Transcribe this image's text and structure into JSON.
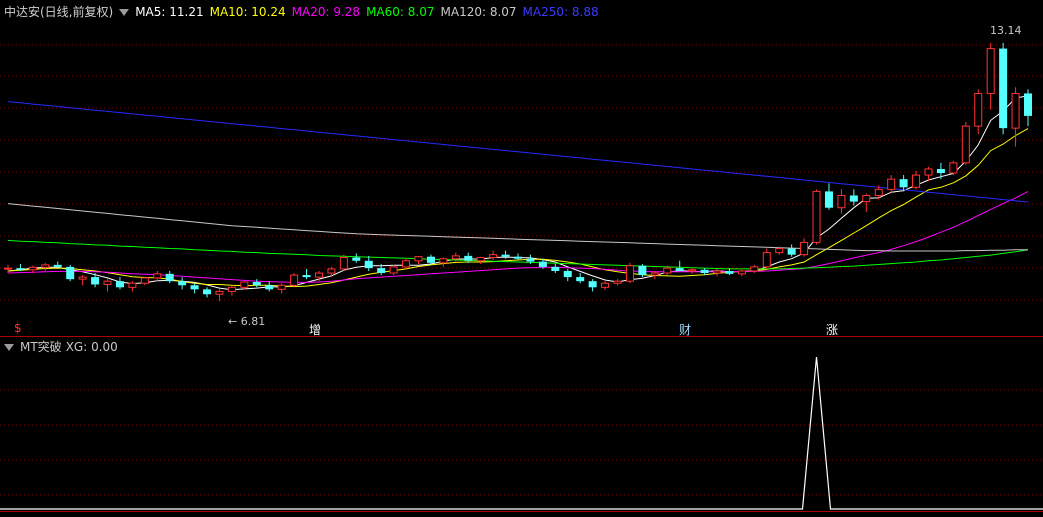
{
  "header": {
    "title": "中达安(日线,前复权)",
    "ma5": "MA5: 11.21",
    "ma10": "MA10: 10.24",
    "ma20": "MA20: 9.28",
    "ma60": "MA60: 8.07",
    "ma120": "MA120: 8.07",
    "ma250": "MA250: 8.88"
  },
  "indicator": {
    "title": "MT突破",
    "xg": "XG: 0.00"
  },
  "labels": {
    "high": "13.14",
    "low": "6.81"
  },
  "markers": [
    {
      "text": "$",
      "color": "#ff3030"
    },
    {
      "text": "增",
      "color": "#ffffff"
    },
    {
      "text": "财",
      "color": "#9fdcff"
    },
    {
      "text": "涨",
      "color": "#ffffff"
    }
  ],
  "colors": {
    "up": "#ff3232",
    "down": "#54ffff",
    "ma5": "#ffffff",
    "ma10": "#ffff00",
    "ma20": "#ff00ff",
    "ma60": "#00ff00",
    "ma120": "#c8c8c8",
    "ma250": "#2828ff",
    "grid": "#7a0000",
    "divider": "#b00000"
  },
  "chart_data": [
    {
      "type": "candlestick",
      "title": "中达安(日线,前复权)",
      "ylim": [
        6.3,
        13.7
      ],
      "ohlc": [
        [
          7.6,
          7.7,
          7.5,
          7.62
        ],
        [
          7.62,
          7.72,
          7.55,
          7.58
        ],
        [
          7.58,
          7.68,
          7.5,
          7.64
        ],
        [
          7.64,
          7.75,
          7.55,
          7.7
        ],
        [
          7.7,
          7.78,
          7.6,
          7.65
        ],
        [
          7.65,
          7.7,
          7.3,
          7.35
        ],
        [
          7.35,
          7.45,
          7.2,
          7.4
        ],
        [
          7.4,
          7.5,
          7.15,
          7.22
        ],
        [
          7.22,
          7.35,
          7.05,
          7.3
        ],
        [
          7.3,
          7.4,
          7.1,
          7.15
        ],
        [
          7.15,
          7.3,
          7.05,
          7.25
        ],
        [
          7.25,
          7.4,
          7.2,
          7.38
        ],
        [
          7.38,
          7.55,
          7.3,
          7.48
        ],
        [
          7.48,
          7.55,
          7.25,
          7.3
        ],
        [
          7.3,
          7.4,
          7.1,
          7.2
        ],
        [
          7.2,
          7.25,
          7.0,
          7.1
        ],
        [
          7.1,
          7.15,
          6.9,
          6.98
        ],
        [
          6.98,
          7.1,
          6.81,
          7.05
        ],
        [
          7.05,
          7.2,
          6.95,
          7.15
        ],
        [
          7.15,
          7.3,
          7.1,
          7.28
        ],
        [
          7.28,
          7.35,
          7.15,
          7.2
        ],
        [
          7.2,
          7.3,
          7.05,
          7.1
        ],
        [
          7.1,
          7.25,
          7.0,
          7.2
        ],
        [
          7.2,
          7.5,
          7.15,
          7.45
        ],
        [
          7.45,
          7.6,
          7.35,
          7.4
        ],
        [
          7.4,
          7.55,
          7.3,
          7.5
        ],
        [
          7.5,
          7.65,
          7.4,
          7.6
        ],
        [
          7.6,
          7.95,
          7.55,
          7.88
        ],
        [
          7.88,
          7.98,
          7.75,
          7.8
        ],
        [
          7.8,
          7.92,
          7.55,
          7.62
        ],
        [
          7.62,
          7.72,
          7.45,
          7.5
        ],
        [
          7.5,
          7.7,
          7.45,
          7.65
        ],
        [
          7.65,
          7.85,
          7.6,
          7.8
        ],
        [
          7.8,
          7.92,
          7.72,
          7.9
        ],
        [
          7.9,
          7.95,
          7.7,
          7.75
        ],
        [
          7.75,
          7.88,
          7.65,
          7.85
        ],
        [
          7.85,
          8.0,
          7.78,
          7.92
        ],
        [
          7.92,
          8.0,
          7.75,
          7.8
        ],
        [
          7.8,
          7.9,
          7.72,
          7.88
        ],
        [
          7.88,
          8.05,
          7.82,
          7.95
        ],
        [
          7.95,
          8.05,
          7.85,
          7.9
        ],
        [
          7.9,
          7.98,
          7.82,
          7.85
        ],
        [
          7.85,
          7.95,
          7.72,
          7.78
        ],
        [
          7.78,
          7.85,
          7.6,
          7.65
        ],
        [
          7.65,
          7.72,
          7.5,
          7.55
        ],
        [
          7.55,
          7.6,
          7.3,
          7.4
        ],
        [
          7.4,
          7.5,
          7.25,
          7.3
        ],
        [
          7.3,
          7.35,
          7.05,
          7.15
        ],
        [
          7.15,
          7.3,
          7.08,
          7.25
        ],
        [
          7.25,
          7.35,
          7.2,
          7.3
        ],
        [
          7.3,
          7.75,
          7.25,
          7.68
        ],
        [
          7.68,
          7.72,
          7.4,
          7.45
        ],
        [
          7.45,
          7.55,
          7.35,
          7.5
        ],
        [
          7.5,
          7.68,
          7.45,
          7.62
        ],
        [
          7.62,
          7.8,
          7.55,
          7.55
        ],
        [
          7.55,
          7.62,
          7.48,
          7.58
        ],
        [
          7.58,
          7.62,
          7.45,
          7.5
        ],
        [
          7.5,
          7.6,
          7.42,
          7.55
        ],
        [
          7.55,
          7.62,
          7.45,
          7.48
        ],
        [
          7.48,
          7.58,
          7.42,
          7.55
        ],
        [
          7.55,
          7.7,
          7.5,
          7.65
        ],
        [
          7.65,
          8.1,
          7.6,
          8.0
        ],
        [
          8.0,
          8.15,
          7.95,
          8.1
        ],
        [
          8.1,
          8.2,
          7.9,
          7.95
        ],
        [
          7.95,
          8.35,
          7.9,
          8.25
        ],
        [
          8.25,
          9.55,
          8.2,
          9.5
        ],
        [
          9.5,
          9.7,
          9.05,
          9.1
        ],
        [
          9.1,
          9.55,
          8.95,
          9.4
        ],
        [
          9.4,
          9.55,
          9.15,
          9.25
        ],
        [
          9.25,
          9.45,
          9.0,
          9.4
        ],
        [
          9.4,
          9.65,
          9.3,
          9.55
        ],
        [
          9.55,
          9.9,
          9.45,
          9.8
        ],
        [
          9.8,
          9.9,
          9.5,
          9.6
        ],
        [
          9.6,
          10.0,
          9.55,
          9.9
        ],
        [
          9.9,
          10.1,
          9.75,
          10.05
        ],
        [
          10.05,
          10.2,
          9.8,
          9.95
        ],
        [
          9.95,
          10.25,
          9.9,
          10.2
        ],
        [
          10.2,
          11.2,
          10.15,
          11.1
        ],
        [
          11.1,
          12.0,
          10.9,
          11.9
        ],
        [
          11.9,
          13.14,
          11.5,
          13.0
        ],
        [
          13.0,
          13.14,
          10.9,
          11.05
        ],
        [
          11.05,
          12.05,
          10.6,
          11.9
        ],
        [
          11.9,
          12.0,
          11.1,
          11.35
        ]
      ],
      "series": [
        {
          "name": "MA5",
          "values": [
            7.55,
            7.58,
            7.62,
            7.64,
            7.64,
            7.58,
            7.53,
            7.46,
            7.38,
            7.28,
            7.24,
            7.26,
            7.31,
            7.32,
            7.3,
            7.27,
            7.21,
            7.13,
            7.09,
            7.11,
            7.13,
            7.16,
            7.16,
            7.19,
            7.27,
            7.35,
            7.43,
            7.57,
            7.64,
            7.68,
            7.68,
            7.69,
            7.69,
            7.69,
            7.72,
            7.79,
            7.84,
            7.85,
            7.84,
            7.88,
            7.89,
            7.88,
            7.87,
            7.83,
            7.77,
            7.65,
            7.54,
            7.43,
            7.33,
            7.28,
            7.34,
            7.37,
            7.44,
            7.52,
            7.56,
            7.54,
            7.53,
            7.56,
            7.53,
            7.53,
            7.55,
            7.65,
            7.77,
            7.85,
            7.99,
            8.36,
            8.58,
            8.84,
            9.1,
            9.33,
            9.34,
            9.48,
            9.52,
            9.65,
            9.78,
            9.86,
            9.94,
            10.24,
            10.64,
            11.24,
            11.47,
            11.79,
            11.84
          ]
        },
        {
          "name": "MA10",
          "values": [
            7.55,
            7.57,
            7.59,
            7.61,
            7.62,
            7.61,
            7.58,
            7.55,
            7.51,
            7.46,
            7.41,
            7.39,
            7.38,
            7.35,
            7.29,
            7.25,
            7.22,
            7.22,
            7.2,
            7.19,
            7.2,
            7.2,
            7.18,
            7.17,
            7.18,
            7.22,
            7.26,
            7.33,
            7.4,
            7.47,
            7.52,
            7.56,
            7.6,
            7.66,
            7.7,
            7.73,
            7.76,
            7.77,
            7.77,
            7.78,
            7.8,
            7.82,
            7.84,
            7.84,
            7.81,
            7.77,
            7.72,
            7.65,
            7.58,
            7.53,
            7.49,
            7.46,
            7.44,
            7.43,
            7.42,
            7.44,
            7.46,
            7.49,
            7.52,
            7.55,
            7.55,
            7.59,
            7.65,
            7.7,
            7.77,
            7.95,
            8.12,
            8.3,
            8.48,
            8.66,
            8.85,
            9.03,
            9.18,
            9.36,
            9.54,
            9.6,
            9.71,
            9.88,
            10.14,
            10.5,
            10.66,
            10.87,
            11.04
          ]
        },
        {
          "name": "MA20",
          "values": [
            7.5,
            7.51,
            7.52,
            7.53,
            7.54,
            7.54,
            7.54,
            7.53,
            7.52,
            7.5,
            7.48,
            7.47,
            7.46,
            7.44,
            7.42,
            7.4,
            7.38,
            7.36,
            7.34,
            7.32,
            7.3,
            7.29,
            7.28,
            7.27,
            7.27,
            7.28,
            7.3,
            7.33,
            7.36,
            7.38,
            7.4,
            7.42,
            7.44,
            7.46,
            7.48,
            7.5,
            7.52,
            7.54,
            7.56,
            7.58,
            7.6,
            7.62,
            7.63,
            7.64,
            7.64,
            7.63,
            7.62,
            7.61,
            7.59,
            7.57,
            7.55,
            7.54,
            7.53,
            7.53,
            7.53,
            7.53,
            7.53,
            7.53,
            7.53,
            7.54,
            7.54,
            7.55,
            7.57,
            7.59,
            7.61,
            7.67,
            7.73,
            7.8,
            7.87,
            7.94,
            8.0,
            8.08,
            8.17,
            8.27,
            8.38,
            8.5,
            8.62,
            8.76,
            8.91,
            9.06,
            9.2,
            9.34,
            9.5
          ]
        },
        {
          "name": "MA60",
          "values": [
            8.3,
            8.28,
            8.27,
            8.25,
            8.24,
            8.22,
            8.21,
            8.19,
            8.18,
            8.16,
            8.15,
            8.13,
            8.12,
            8.1,
            8.09,
            8.07,
            8.06,
            8.04,
            8.03,
            8.01,
            8.0,
            7.98,
            7.97,
            7.96,
            7.95,
            7.93,
            7.92,
            7.91,
            7.9,
            7.89,
            7.88,
            7.87,
            7.86,
            7.85,
            7.84,
            7.83,
            7.82,
            7.81,
            7.8,
            7.79,
            7.78,
            7.77,
            7.76,
            7.75,
            7.74,
            7.73,
            7.72,
            7.71,
            7.7,
            7.69,
            7.68,
            7.67,
            7.66,
            7.65,
            7.64,
            7.63,
            7.62,
            7.61,
            7.6,
            7.6,
            7.6,
            7.6,
            7.6,
            7.61,
            7.62,
            7.63,
            7.64,
            7.66,
            7.67,
            7.69,
            7.71,
            7.73,
            7.75,
            7.77,
            7.8,
            7.82,
            7.85,
            7.88,
            7.91,
            7.94,
            7.98,
            8.02,
            8.07
          ]
        },
        {
          "name": "MA120",
          "values": [
            9.2,
            9.17,
            9.14,
            9.11,
            9.08,
            9.05,
            9.02,
            8.99,
            8.96,
            8.93,
            8.9,
            8.87,
            8.84,
            8.81,
            8.78,
            8.75,
            8.72,
            8.69,
            8.66,
            8.64,
            8.62,
            8.6,
            8.58,
            8.56,
            8.54,
            8.52,
            8.5,
            8.48,
            8.46,
            8.45,
            8.44,
            8.43,
            8.42,
            8.41,
            8.4,
            8.39,
            8.38,
            8.37,
            8.36,
            8.35,
            8.34,
            8.33,
            8.32,
            8.31,
            8.3,
            8.29,
            8.28,
            8.27,
            8.26,
            8.25,
            8.24,
            8.23,
            8.22,
            8.21,
            8.2,
            8.19,
            8.18,
            8.17,
            8.16,
            8.15,
            8.14,
            8.13,
            8.12,
            8.11,
            8.1,
            8.09,
            8.08,
            8.07,
            8.06,
            8.05,
            8.05,
            8.04,
            8.04,
            8.04,
            8.04,
            8.04,
            8.04,
            8.05,
            8.05,
            8.06,
            8.06,
            8.07,
            8.07
          ]
        },
        {
          "name": "MA250",
          "values": [
            11.7,
            11.67,
            11.64,
            11.61,
            11.58,
            11.55,
            11.52,
            11.49,
            11.46,
            11.43,
            11.4,
            11.37,
            11.34,
            11.31,
            11.28,
            11.25,
            11.22,
            11.19,
            11.16,
            11.13,
            11.1,
            11.07,
            11.04,
            11.01,
            10.98,
            10.95,
            10.92,
            10.89,
            10.86,
            10.83,
            10.8,
            10.77,
            10.74,
            10.71,
            10.68,
            10.65,
            10.62,
            10.59,
            10.56,
            10.53,
            10.5,
            10.47,
            10.44,
            10.41,
            10.38,
            10.35,
            10.32,
            10.29,
            10.26,
            10.23,
            10.2,
            10.17,
            10.14,
            10.11,
            10.08,
            10.05,
            10.02,
            9.99,
            9.96,
            9.93,
            9.9,
            9.87,
            9.84,
            9.81,
            9.78,
            9.75,
            9.72,
            9.69,
            9.66,
            9.63,
            9.6,
            9.57,
            9.54,
            9.51,
            9.48,
            9.45,
            9.42,
            9.39,
            9.36,
            9.33,
            9.3,
            9.27,
            9.24
          ]
        }
      ]
    },
    {
      "type": "line",
      "title": "MT突破",
      "name": "XG",
      "ylim": [
        0,
        1
      ],
      "pulse_index": 65,
      "values_note_length": 83
    }
  ]
}
